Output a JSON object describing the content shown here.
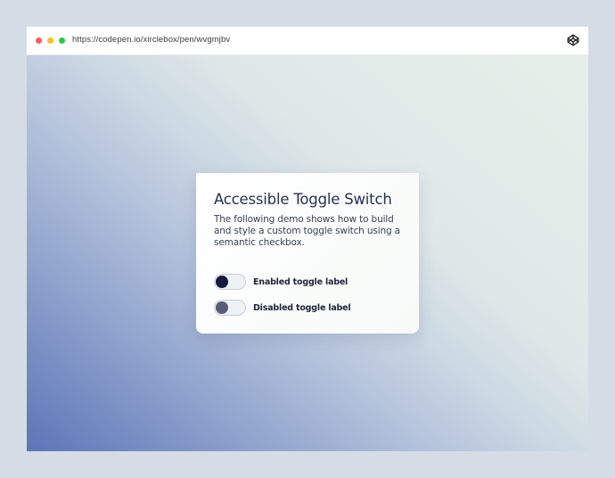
{
  "browser": {
    "url": "https://codepen.io/xirclebox/pen/wvgmjbv",
    "icon": "codepen-icon"
  },
  "card": {
    "title": "Accessible Toggle Switch",
    "description": "The following demo shows how to build and style a custom toggle switch using a semantic checkbox.",
    "toggles": [
      {
        "label": "Enabled toggle label",
        "state": "off",
        "enabled": true
      },
      {
        "label": "Disabled toggle label",
        "state": "off",
        "enabled": false
      }
    ]
  },
  "colors": {
    "knob_enabled": "#161b3e",
    "knob_disabled": "#585c79",
    "title": "#263250"
  }
}
